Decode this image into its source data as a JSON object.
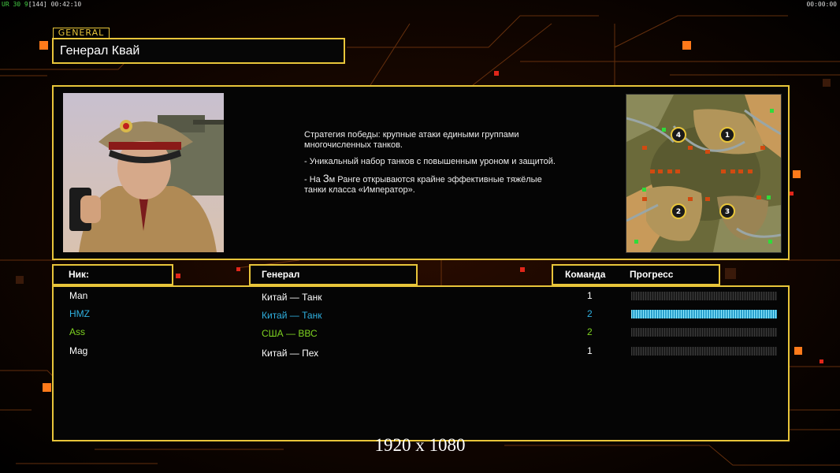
{
  "debug": {
    "left_status": "UR 30 9",
    "left_extra": "[144]",
    "left_time": "00:42:10",
    "right_time": "00:00:00"
  },
  "header": {
    "tag": "GENERAL",
    "title": "Генерал Квай"
  },
  "description": {
    "p1": "Стратегия победы: крупные атаки едиными группами многочисленных танков.",
    "p2": "- Уникальный набор танков с повышенным уроном и защитой.",
    "p3_pre": "- На ",
    "p3_num": "3",
    "p3_post": "м Ранге открываются крайне эффективные тяжёлые танки класса «Император»."
  },
  "minimap": {
    "start_positions": [
      "4",
      "1",
      "2",
      "3"
    ]
  },
  "columns": {
    "nick": "Ник:",
    "general": "Генерал",
    "team": "Команда",
    "progress": "Прогресс"
  },
  "players": [
    {
      "nick": "Man",
      "general": "Китай — Танк",
      "team": "1",
      "progress": 0,
      "color": "#ffffff"
    },
    {
      "nick": "HMZ",
      "general": "Китай — Танк",
      "team": "2",
      "progress": 1,
      "color": "#2fb0e0"
    },
    {
      "nick": "Ass",
      "general": "США — ВВС",
      "team": "2",
      "progress": 0,
      "color": "#7ed321"
    },
    {
      "nick": "Mag",
      "general": "Китай — Пех",
      "team": "1",
      "progress": 0,
      "color": "#ffffff"
    }
  ],
  "resolution_label": "1920 x 1080",
  "colors": {
    "accent": "#e8c53a",
    "orange": "#ff7a1a"
  }
}
